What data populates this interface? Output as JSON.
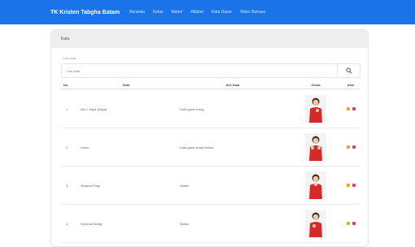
{
  "navbar": {
    "brand": "TK Kristen Tabgha Batam",
    "links": [
      "Beranda",
      "Kelas",
      "Materi",
      "Alfabet",
      "Kata Dasar",
      "Video Bahasa"
    ]
  },
  "card": {
    "header": "Kata",
    "search": {
      "label": "Cari kata",
      "placeholder": "Cari kata"
    },
    "columns": [
      "No",
      "Kata",
      "Arti Kata",
      "Gerak",
      "Aksi"
    ],
    "rows": [
      {
        "no": "1",
        "name": "Aku / Saya (Saya)",
        "definition": "Kata ganti orang"
      },
      {
        "no": "2",
        "name": "Kamu",
        "definition": "Kata ganti orang kedua"
      },
      {
        "no": "3",
        "name": "Selamat Pagi",
        "definition": "Salam"
      },
      {
        "no": "4",
        "name": "Selamat Siang",
        "definition": "Salam"
      }
    ]
  },
  "colors": {
    "navbar": "#1a73e8",
    "edit": "#f0a030",
    "delete": "#e04848",
    "shirt": "#d42a2a"
  },
  "icons": [
    "search-icon",
    "edit-icon",
    "delete-icon"
  ]
}
